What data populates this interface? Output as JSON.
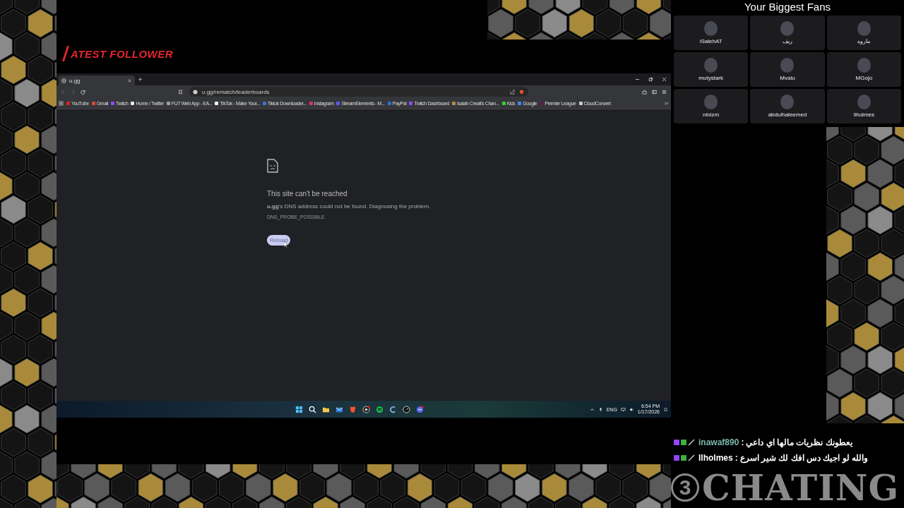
{
  "overlay": {
    "follower_label": "ATEST FOLLOWER"
  },
  "browser": {
    "tab": {
      "title": "u.gg"
    },
    "address": "u.gg/rematch/leaderboards",
    "bookmarks": [
      {
        "label": "YouTube",
        "color": "#e02020"
      },
      {
        "label": "Gmail",
        "color": "#d9473b"
      },
      {
        "label": "Twitch",
        "color": "#9146ff"
      },
      {
        "label": "Home / Twitter",
        "color": "#e8e8e8"
      },
      {
        "label": "FUT Web App - EA...",
        "color": "#9aa0a6"
      },
      {
        "label": "TikTok - Make Your...",
        "color": "#f0f0f0"
      },
      {
        "label": "Tiktok Downloader...",
        "color": "#3f6fd8"
      },
      {
        "label": "Instagram",
        "color": "#d6307a"
      },
      {
        "label": "StreamElements - M...",
        "color": "#5b5bf0"
      },
      {
        "label": "PayPal",
        "color": "#2a6fd6"
      },
      {
        "label": "Twitch Dashboard",
        "color": "#9146ff"
      },
      {
        "label": "Isaiah Creati's Chan...",
        "color": "#b08a50"
      },
      {
        "label": "Kick",
        "color": "#35d02c"
      },
      {
        "label": "Google",
        "color": "#4285f4"
      },
      {
        "label": "Premier League",
        "color": "#5a1b4a"
      },
      {
        "label": "CloudConvert",
        "color": "#c8c8c8"
      }
    ],
    "error": {
      "title": "This site can't be reached",
      "message": "**u.gg**'s DNS address could not be found. Diagnosing the problem.",
      "code": "DNS_PROBE_POSSIBLE",
      "button": "Reload"
    }
  },
  "taskbar": {
    "apps": [
      {
        "kind": "windows"
      },
      {
        "kind": "search"
      },
      {
        "kind": "folder"
      },
      {
        "kind": "mail"
      },
      {
        "kind": "brave"
      },
      {
        "kind": "camera"
      },
      {
        "kind": "spotify"
      },
      {
        "kind": "cleaner"
      },
      {
        "kind": "dial"
      },
      {
        "kind": "discord"
      }
    ],
    "language": "ENG",
    "time": "6:54 PM",
    "date": "1/17/2026"
  },
  "fans": {
    "title": "Your Biggest Fans",
    "items": [
      {
        "name": "iSalehAT"
      },
      {
        "name": "ريف"
      },
      {
        "name": "ماروه"
      },
      {
        "name": "mutystark"
      },
      {
        "name": "Mvalu"
      },
      {
        "name": "MGojo"
      },
      {
        "name": "ninizm"
      },
      {
        "name": "abdulhaleemed"
      },
      {
        "name": "llholmes"
      }
    ]
  },
  "chat": {
    "messages": [
      {
        "username": "inawaf890",
        "color": "#7ab8a8",
        "separator": ":",
        "text": "يعطونك نظريات مالها اي داعي"
      },
      {
        "username": "llholmes",
        "color": "#ffffff",
        "separator": ":",
        "text": "والله لو اجيك دس افك لك شير اسرع"
      }
    ]
  },
  "logo": {
    "badge": "3",
    "text": "CHATING"
  }
}
